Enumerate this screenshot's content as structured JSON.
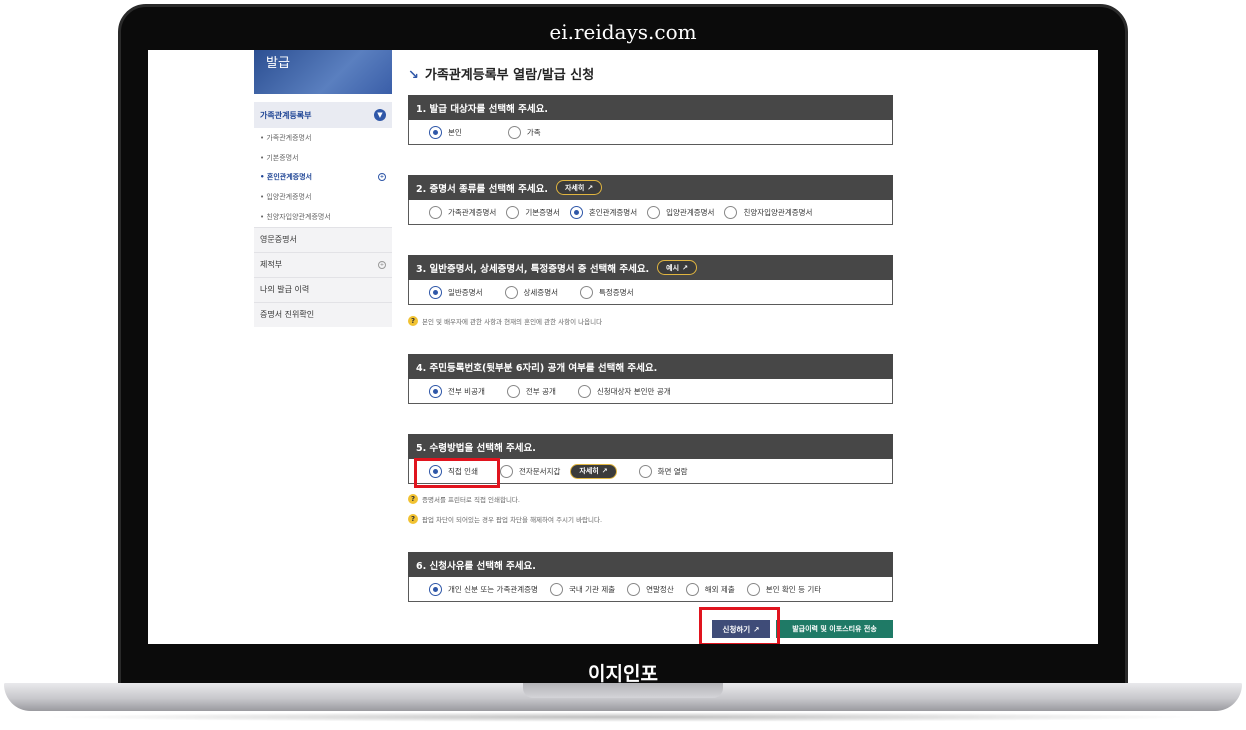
{
  "window": {
    "site_url": "ei.reidays.com",
    "brand": "이지인포"
  },
  "sidebar": {
    "banner_text": "발급",
    "header": "가족관계등록부",
    "sub_items": [
      {
        "label": "가족관계증명서",
        "active": false
      },
      {
        "label": "기본증명서",
        "active": false
      },
      {
        "label": "혼인관계증명서",
        "active": true
      },
      {
        "label": "입양관계증명서",
        "active": false
      },
      {
        "label": "친양자입양관계증명서",
        "active": false
      }
    ],
    "menu_items": [
      {
        "label": "영문증명서"
      },
      {
        "label": "제적부"
      },
      {
        "label": "나의 발급 이력"
      },
      {
        "label": "증명서 진위확인"
      }
    ]
  },
  "main": {
    "title": "가족관계등록부 열람/발급 신청",
    "sections": [
      {
        "heading": "1. 발급 대상자를 선택해 주세요.",
        "options": [
          "본인",
          "가족"
        ],
        "selected": 0
      },
      {
        "heading": "2. 증명서 종류를 선택해 주세요.",
        "badge": "자세히",
        "options": [
          "가족관계증명서",
          "기본증명서",
          "혼인관계증명서",
          "입양관계증명서",
          "친양자입양관계증명서"
        ],
        "selected": 2
      },
      {
        "heading": "3. 일반증명서, 상세증명서, 특정증명서 중 선택해 주세요.",
        "badge": "예시",
        "options": [
          "일반증명서",
          "상세증명서",
          "특정증명서"
        ],
        "selected": 0,
        "notes": [
          "본인 및 배우자에 관한 사항과 현재의 혼인에 관한 사항이 나옵니다"
        ]
      },
      {
        "heading": "4. 주민등록번호(뒷부분 6자리) 공개 여부를 선택해 주세요.",
        "options": [
          "전부 비공개",
          "전부 공개",
          "신청대상자 본인만 공개"
        ],
        "selected": 0
      },
      {
        "heading": "5. 수령방법을 선택해 주세요.",
        "options": [
          "직접 인쇄",
          "전자문서지갑",
          "화면 열람"
        ],
        "inline_badge": "자세히",
        "selected": 0,
        "notes": [
          "증명서를 프린터로 직접 인쇄합니다.",
          "팝업 차단이 되어있는 경우 팝업 차단을 해제하여 주시기 바랍니다."
        ]
      },
      {
        "heading": "6. 신청사유를 선택해 주세요.",
        "options": [
          "개인 신분 또는 가족관계증명",
          "국내 기관 제출",
          "연말정산",
          "해외 제출",
          "본인 확인 등 기타"
        ],
        "selected": 0
      }
    ],
    "buttons": {
      "apply": "신청하기",
      "send": "발급이력 및 이포스티유 전송"
    }
  },
  "colors": {
    "section_header": "#474747",
    "accent": "#2f57a8",
    "highlight": "#e0141e",
    "send_button": "#1f7a66"
  }
}
